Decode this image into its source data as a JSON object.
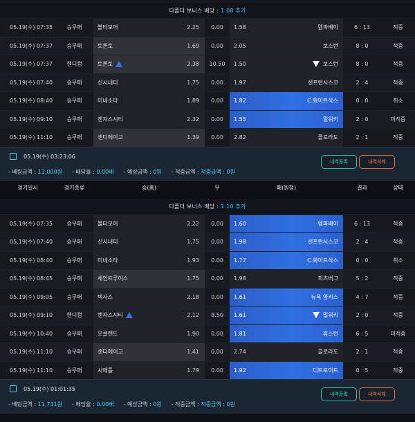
{
  "colors": {
    "accent_blue": "#2f70e2",
    "bonus_blue": "#44c0ff",
    "register_green": "#37d2b5",
    "delete_orange": "#f07a40"
  },
  "columns": [
    "경기일시",
    "경기종류",
    "승(홈)",
    "무",
    "패(원정)",
    "결과",
    "상태"
  ],
  "slips": [
    {
      "header": {
        "text": "다폴더 보너스 배당 :",
        "bonus": "1.08 추가"
      },
      "rows": [
        {
          "date": "05.19(수) 07:35",
          "type": "승무패",
          "home": "볼티모어",
          "home_odds": "2.25",
          "draw": "0.00",
          "away_odds": "1.58",
          "away": "템파베이",
          "score": "6 : 13",
          "result": "적중",
          "selected": "none",
          "home_icon": "",
          "away_icon": ""
        },
        {
          "date": "05.19(수) 07:37",
          "type": "승무패",
          "home": "토론토",
          "home_odds": "1.69",
          "draw": "0.00",
          "away_odds": "2.05",
          "away": "보스턴",
          "score": "8 : 0",
          "result": "적중",
          "selected": "home",
          "home_icon": "",
          "away_icon": ""
        },
        {
          "date": "05.19(수) 07:37",
          "type": "핸디캡",
          "home": "토론토",
          "home_odds": "2.38",
          "draw": "10.50",
          "away_odds": "1.50",
          "away": "보스턴",
          "score": "8 : 0",
          "result": "적중",
          "selected": "home",
          "home_icon": "up",
          "away_icon": "down"
        },
        {
          "date": "05.19(수) 07:40",
          "type": "승무패",
          "home": "신시내티",
          "home_odds": "1.75",
          "draw": "0.00",
          "away_odds": "1.97",
          "away": "샌프란시스코",
          "score": "2 : 4",
          "result": "적중",
          "selected": "none",
          "home_icon": "",
          "away_icon": ""
        },
        {
          "date": "05.19(수) 08:40",
          "type": "승무패",
          "home": "미네소타",
          "home_odds": "1.89",
          "draw": "0.00",
          "away_odds": "1.82",
          "away": "C.화이트삭스",
          "score": "0 : 0",
          "result": "취소",
          "selected": "away",
          "home_icon": "",
          "away_icon": ""
        },
        {
          "date": "05.19(수) 09:10",
          "type": "승무패",
          "home": "캔자스시티",
          "home_odds": "2.32",
          "draw": "0.00",
          "away_odds": "1.55",
          "away": "밀워키",
          "score": "2 : 0",
          "result": "미적중",
          "selected": "away",
          "home_icon": "",
          "away_icon": ""
        },
        {
          "date": "05.19(수) 11:10",
          "type": "승무패",
          "home": "샌디에이고",
          "home_odds": "1.39",
          "draw": "0.00",
          "away_odds": "2.82",
          "away": "콜로라도",
          "score": "2 : 1",
          "result": "적중",
          "selected": "home",
          "home_icon": "",
          "away_icon": ""
        }
      ],
      "summary": {
        "timestamp": "05.19(수) 03:23:06",
        "bet_label": "베팅금액 :",
        "bet_value": "11,000원",
        "rate_label": "배당율 :",
        "rate_value": "0.00배",
        "expected_label": "예상금액 :",
        "expected_value": "0원",
        "win_label": "적중금액 :",
        "win_value": "적중금액 : 0원",
        "register_label": "내역등록",
        "delete_label": "내역삭제"
      }
    },
    {
      "header": {
        "text": "다폴더 보너스 배당 :",
        "bonus": "1.10 추가"
      },
      "rows": [
        {
          "date": "05.19(수) 07:35",
          "type": "승무패",
          "home": "볼티모어",
          "home_odds": "2.22",
          "draw": "0.00",
          "away_odds": "1.60",
          "away": "템파베이",
          "score": "6 : 13",
          "result": "적중",
          "selected": "away",
          "home_icon": "",
          "away_icon": ""
        },
        {
          "date": "05.19(수) 07:40",
          "type": "승무패",
          "home": "신시내티",
          "home_odds": "1.75",
          "draw": "0.00",
          "away_odds": "1.98",
          "away": "샌프란시스코",
          "score": "2 : 4",
          "result": "적중",
          "selected": "away",
          "home_icon": "",
          "away_icon": ""
        },
        {
          "date": "05.19(수) 08:40",
          "type": "승무패",
          "home": "미네소타",
          "home_odds": "1.93",
          "draw": "0.00",
          "away_odds": "1.77",
          "away": "C.화이트삭스",
          "score": "0 : 0",
          "result": "취소",
          "selected": "away",
          "home_icon": "",
          "away_icon": ""
        },
        {
          "date": "05.19(수) 08:45",
          "type": "승무패",
          "home": "세인트루이스",
          "home_odds": "1.75",
          "draw": "0.00",
          "away_odds": "1.98",
          "away": "피츠버그",
          "score": "5 : 2",
          "result": "적중",
          "selected": "home",
          "home_icon": "",
          "away_icon": ""
        },
        {
          "date": "05.19(수) 09:05",
          "type": "승무패",
          "home": "텍사스",
          "home_odds": "2.18",
          "draw": "0.00",
          "away_odds": "1.61",
          "away": "뉴욕 양키스",
          "score": "4 : 7",
          "result": "적중",
          "selected": "away",
          "home_icon": "",
          "away_icon": ""
        },
        {
          "date": "05.19(수) 09:10",
          "type": "핸디캡",
          "home": "캔자스시티",
          "home_odds": "2.12",
          "draw": "8.50",
          "away_odds": "1.61",
          "away": "밀워키",
          "score": "2 : 0",
          "result": "적중",
          "selected": "away",
          "home_icon": "up",
          "away_icon": "down"
        },
        {
          "date": "05.19(수) 10:40",
          "type": "승무패",
          "home": "오클랜드",
          "home_odds": "1.90",
          "draw": "0.00",
          "away_odds": "1.81",
          "away": "휴스턴",
          "score": "6 : 5",
          "result": "미적중",
          "selected": "away",
          "home_icon": "",
          "away_icon": ""
        },
        {
          "date": "05.19(수) 11:10",
          "type": "승무패",
          "home": "샌디에이고",
          "home_odds": "1.41",
          "draw": "0.00",
          "away_odds": "2.74",
          "away": "콜로라도",
          "score": "2 : 1",
          "result": "적중",
          "selected": "home",
          "home_icon": "",
          "away_icon": ""
        },
        {
          "date": "05.19(수) 11:10",
          "type": "승무패",
          "home": "시애틀",
          "home_odds": "1.79",
          "draw": "0.00",
          "away_odds": "1.92",
          "away": "디트로이트",
          "score": "0 : 5",
          "result": "적중",
          "selected": "away",
          "home_icon": "",
          "away_icon": ""
        }
      ],
      "summary": {
        "timestamp": "05.19(수) 01:01:35",
        "bet_label": "베팅금액 :",
        "bet_value": "11,731원",
        "rate_label": "배당율 :",
        "rate_value": "0.00배",
        "expected_label": "예상금액 :",
        "expected_value": "0원",
        "win_label": "적중금액 :",
        "win_value": "적중금액 : 0원",
        "register_label": "내역등록",
        "delete_label": "내역삭제"
      }
    }
  ]
}
